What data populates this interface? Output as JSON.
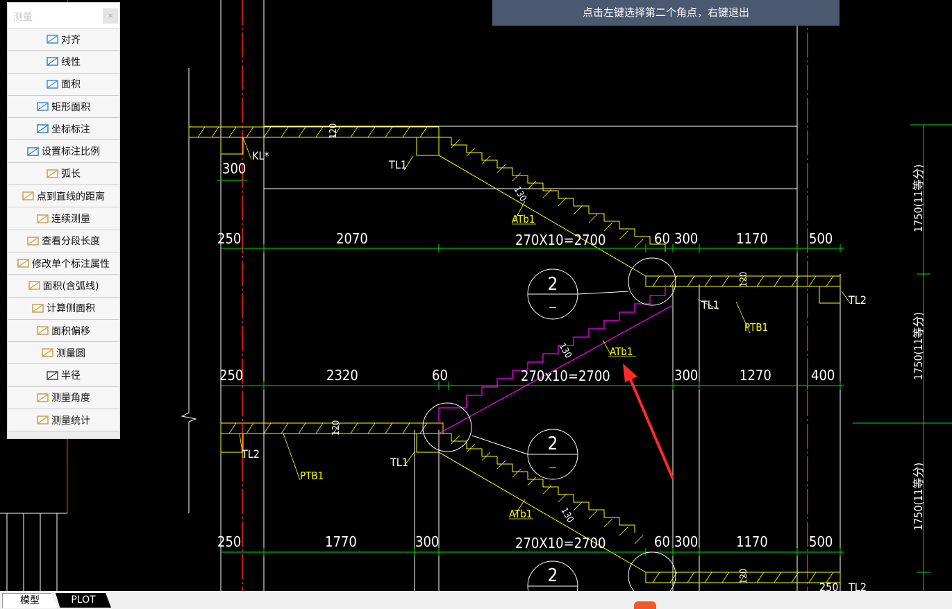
{
  "prompt_text": "点击左键选择第二个角点，右键退出",
  "panel": {
    "title": "测量",
    "close": "×",
    "items": [
      {
        "label": "对齐",
        "icon": "aligned-dimension-icon"
      },
      {
        "label": "线性",
        "icon": "linear-dimension-icon"
      },
      {
        "label": "面积",
        "icon": "area-icon"
      },
      {
        "label": "矩形面积",
        "icon": "rectangle-area-icon"
      },
      {
        "label": "坐标标注",
        "icon": "coordinate-icon"
      },
      {
        "label": "设置标注比例",
        "icon": "scale-icon"
      },
      {
        "label": "弧长",
        "icon": "arc-length-icon"
      },
      {
        "label": "点到直线的距离",
        "icon": "point-line-distance-icon"
      },
      {
        "label": "连续测量",
        "icon": "continuous-measure-icon"
      },
      {
        "label": "查看分段长度",
        "icon": "segment-length-icon"
      },
      {
        "label": "修改单个标注属性",
        "icon": "edit-dimension-icon"
      },
      {
        "label": "面积(含弧线)",
        "icon": "arc-area-icon"
      },
      {
        "label": "计算侧面积",
        "icon": "side-area-icon"
      },
      {
        "label": "面积偏移",
        "icon": "area-offset-icon"
      },
      {
        "label": "测量圆",
        "icon": "measure-circle-icon"
      },
      {
        "label": "半径",
        "icon": "radius-icon"
      },
      {
        "label": "测量角度",
        "icon": "measure-angle-icon"
      },
      {
        "label": "测量统计",
        "icon": "measure-stats-icon"
      }
    ]
  },
  "tabs": [
    "模型",
    "PLOT"
  ],
  "drawing": {
    "colors": {
      "white": "#ffffff",
      "red": "#ff2020",
      "green": "#00e000",
      "yellow": "#ffff00",
      "magenta": "#ff00ff",
      "arrow": "#ff2a2a"
    },
    "dim_row1": [
      "250",
      "2070",
      "270X10=2700",
      "60",
      "300",
      "1170",
      "500"
    ],
    "dim_row2": [
      "250",
      "2320",
      "60",
      "270x10=2700",
      "300",
      "1270",
      "400"
    ],
    "dim_row3": [
      "250",
      "1770",
      "300",
      "270X10=2700",
      "60",
      "300",
      "1170",
      "500"
    ],
    "dim_misc": [
      "300",
      "120",
      "130",
      "120",
      "120",
      "130",
      "130",
      "120",
      "250"
    ],
    "vertical_dims": [
      "1750(11等分)",
      "1750(11等分)",
      "1750(11等分)"
    ],
    "labels": {
      "kl": "KL*",
      "tl1": "TL1",
      "tl2": "TL2",
      "atb1": "ATb1",
      "ptb1": "PTB1",
      "circle_top": "2",
      "circle_bottom": "—"
    }
  }
}
